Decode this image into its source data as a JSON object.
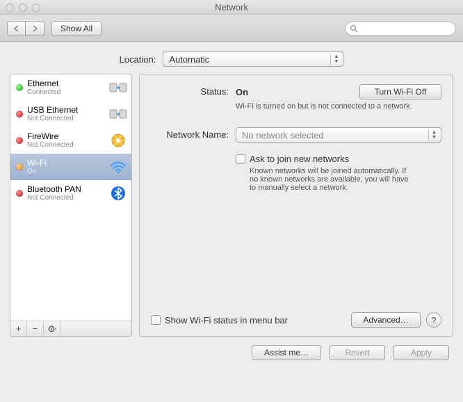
{
  "window": {
    "title": "Network"
  },
  "toolbar": {
    "show_all": "Show All",
    "search_placeholder": ""
  },
  "location": {
    "label": "Location:",
    "value": "Automatic"
  },
  "sidebar": {
    "items": [
      {
        "name": "Ethernet",
        "sub": "Connected",
        "status": "green",
        "icon": "ethernet"
      },
      {
        "name": "USB Ethernet",
        "sub": "Not Connected",
        "status": "red",
        "icon": "ethernet"
      },
      {
        "name": "FireWire",
        "sub": "Not Connected",
        "status": "red",
        "icon": "firewire"
      },
      {
        "name": "Wi-Fi",
        "sub": "On",
        "status": "orange",
        "icon": "wifi"
      },
      {
        "name": "Bluetooth PAN",
        "sub": "Not Connected",
        "status": "red",
        "icon": "bluetooth"
      }
    ],
    "selected_index": 3
  },
  "detail": {
    "status_label": "Status:",
    "status_value": "On",
    "status_sub": "Wi-Fi is turned on but is not connected to a network.",
    "toggle_button": "Turn Wi-Fi Off",
    "network_name_label": "Network Name:",
    "network_name_value": "No network selected",
    "ask_join_label": "Ask to join new networks",
    "ask_join_sub": "Known networks will be joined automatically. If no known networks are available, you will have to manually select a network.",
    "show_status_label": "Show Wi-Fi status in menu bar",
    "advanced_button": "Advanced…"
  },
  "bottom": {
    "assist": "Assist me…",
    "revert": "Revert",
    "apply": "Apply"
  }
}
